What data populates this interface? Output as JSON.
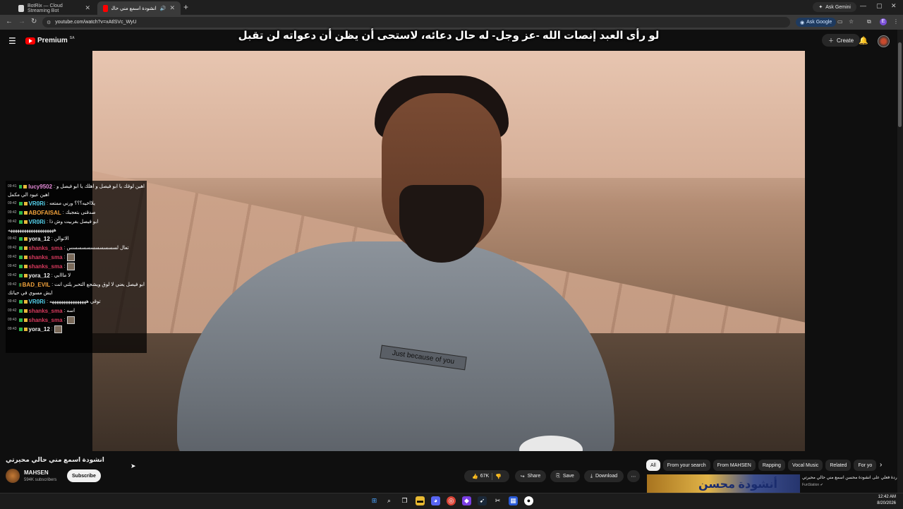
{
  "browser": {
    "tabs": [
      {
        "title": "BotRix — Cloud Streaming Bot",
        "active": false
      },
      {
        "title": "انشودة اسمع مني حالي محيرتي",
        "active": true
      }
    ],
    "ask_gemini": "Ask Gemini",
    "url": "youtube.com/watch?v=xAtlSVc_WyU",
    "ask_google": "Ask Google",
    "profile_letter": "E"
  },
  "youtube": {
    "logo_text": "Premium",
    "logo_country": "SA",
    "create_label": "Create",
    "caption": "لو رأى العبد إنصات الله -عز وجل- له حال دعائه، لاستحى أن يظن أن دعواته لن تقبل",
    "shirt_text": "Just because of you",
    "video_title": "انشودة اسمع مني حالي محيرتي",
    "channel": {
      "name": "MAHSEN",
      "subscribers": "594K subscribers",
      "subscribe_label": "Subscribe"
    },
    "actions": {
      "likes": "67K",
      "share": "Share",
      "save": "Save",
      "download": "Download"
    },
    "chips": [
      "All",
      "From your search",
      "From MAHSEN",
      "Rapping",
      "Vocal Music",
      "Related",
      "For yo"
    ],
    "recommendation": {
      "thumb_text": "أنشودة محسن",
      "title": "ردة فعلي على انشودة محسن اسمع مني حالي محيرتي",
      "channel": "FunStation"
    }
  },
  "chat": [
    {
      "time": "09:41",
      "user": "lucy9502",
      "color": "#e48ad8",
      "msg": "اهين لوقك يا ابو فيصل و اهلك يا ابو فيصل و",
      "cont": "اهين عيود الي مكمل"
    },
    {
      "time": "09:42",
      "user": "VR0Ri",
      "color": "#56d5f0",
      "msg": "يلااخيه؟؟؟ ورني ممتعه"
    },
    {
      "time": "09:42",
      "user": "ABOFAISAL",
      "color": "#f2a23b",
      "msg": "صدقنى بتعجبك"
    },
    {
      "time": "09:42",
      "user": "VR0Ri",
      "color": "#56d5f0",
      "msg": "ابو فيصل بغربيت وش ذا",
      "cont": "ههههههههههههههههههههه"
    },
    {
      "time": "09:42",
      "user": "yora_12",
      "color": "#f1f1f1",
      "msg": "الاتوالن"
    },
    {
      "time": "09:42",
      "user": "shanks_sma",
      "color": "#d93a5e",
      "msg": "تعال لسسسسسسسسسسس"
    },
    {
      "time": "09:42",
      "user": "shanks_sma",
      "color": "#d93a5e",
      "msg": ""
    },
    {
      "time": "09:42",
      "user": "shanks_sma",
      "color": "#d93a5e",
      "msg": ""
    },
    {
      "time": "09:42",
      "user": "yora_12",
      "color": "#f1f1f1",
      "msg": "لا مااابي"
    },
    {
      "time": "09:42",
      "user": "BAD_EVIL",
      "color": "#f2a23b",
      "msg": "ابو فيصل يعني لا لوق ويشجع التحبر يلتي انت",
      "cont": "ايش مسوي في حياتك"
    },
    {
      "time": "09:42",
      "user": "VR0Ri",
      "color": "#56d5f0",
      "msg": "توقي ههههههههههههههههه"
    },
    {
      "time": "09:42",
      "user": "shanks_sma",
      "color": "#d93a5e",
      "msg": "اسه"
    },
    {
      "time": "09:43",
      "user": "shanks_sma",
      "color": "#d93a5e",
      "msg": ""
    },
    {
      "time": "09:43",
      "user": "yora_12",
      "color": "#f1f1f1",
      "msg": ""
    }
  ],
  "taskbar": {
    "time": "12:42 AM",
    "date": "8/20/2026"
  }
}
